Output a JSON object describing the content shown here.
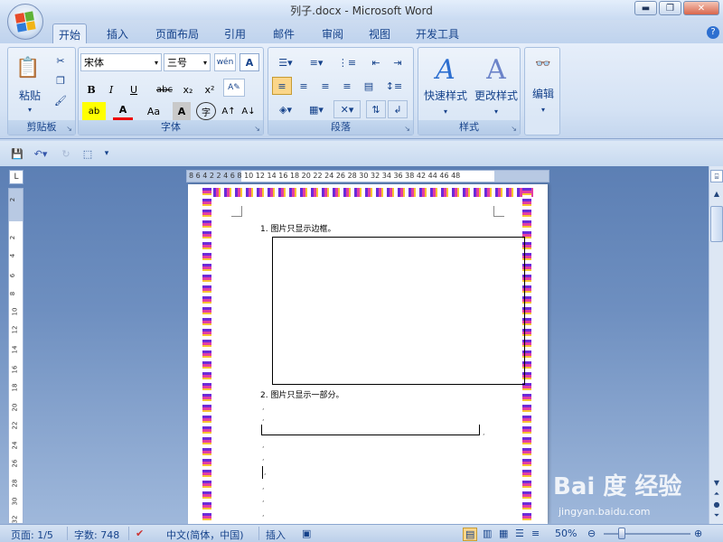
{
  "window": {
    "title": "列子.docx - Microsoft Word"
  },
  "tabs": [
    "开始",
    "插入",
    "页面布局",
    "引用",
    "邮件",
    "审阅",
    "视图",
    "开发工具"
  ],
  "ribbon": {
    "clipboard": {
      "label": "剪贴板",
      "paste": "粘贴"
    },
    "font": {
      "label": "字体",
      "font_name": "宋体",
      "font_size": "三号",
      "wen": "wén\n变",
      "A_box": "A",
      "bold": "B",
      "italic": "I",
      "underline": "U",
      "strike": "abc",
      "sub": "x₂",
      "sup": "x²",
      "font_color": "A",
      "case": "Aa",
      "char_shading": "A",
      "enclose": "字",
      "grow": "A↑",
      "shrink": "A↓"
    },
    "paragraph": {
      "label": "段落"
    },
    "styles": {
      "label": "样式",
      "quick": "快速样式",
      "change": "更改样式"
    },
    "editing": {
      "label": "编辑"
    }
  },
  "ruler": {
    "h_numbers": "8  6  4  2     2  4  6  8 10 12 14 16 18 20 22 24 26 28 30 32 34 36 38    42 44 46 48",
    "v_numbers": [
      "2",
      "2",
      "4",
      "6",
      "8",
      "10",
      "12",
      "14",
      "16",
      "18",
      "20",
      "22",
      "24",
      "26",
      "28",
      "30",
      "32"
    ]
  },
  "document": {
    "line1": "1. 图片只显示边框。",
    "line2": "2. 图片只显示一部分。"
  },
  "status": {
    "page": "页面: 1/5",
    "words": "字数: 748",
    "language": "中文(简体，中国)",
    "insert": "插入",
    "zoom": "50%"
  },
  "watermark": {
    "logo": "Bai 度 经验",
    "url": "jingyan.baidu.com"
  }
}
